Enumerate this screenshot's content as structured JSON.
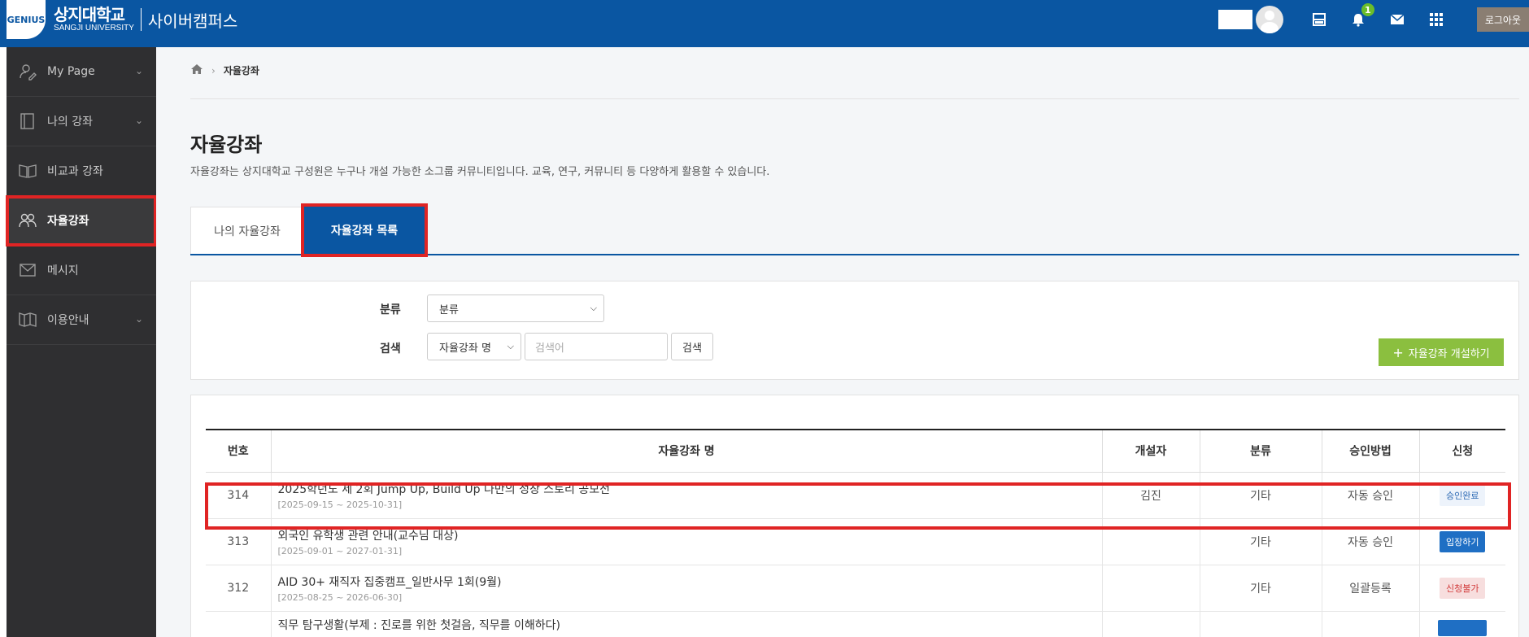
{
  "header": {
    "logo_emblem": "GENIUS",
    "logo_kr": "상지대학교",
    "logo_en": "SANGJI UNIVERSITY",
    "site_name": "사이버캠퍼스",
    "notification_count": "1",
    "logout_label": "로그아웃",
    "icons": [
      "avatar",
      "layout-icon",
      "bell-icon",
      "mail-icon",
      "apps-grid-icon"
    ]
  },
  "sidebar": {
    "items": [
      {
        "label": "My Page",
        "icon": "user-edit-icon",
        "has_chevron": true
      },
      {
        "label": "나의 강좌",
        "icon": "book-icon",
        "has_chevron": true
      },
      {
        "label": "비교과 강좌",
        "icon": "open-book-icon",
        "has_chevron": false
      },
      {
        "label": "자율강좌",
        "icon": "group-icon",
        "has_chevron": false,
        "active": true
      },
      {
        "label": "메시지",
        "icon": "mail-icon",
        "has_chevron": false
      },
      {
        "label": "이용안내",
        "icon": "guide-icon",
        "has_chevron": true
      }
    ]
  },
  "breadcrumb": {
    "current": "자율강좌"
  },
  "page": {
    "title": "자율강좌",
    "description": "자율강좌는 상지대학교 구성원은 누구나 개설 가능한 소그룹 커뮤니티입니다. 교육, 연구, 커뮤니티 등 다양하게 활용할 수 있습니다."
  },
  "tabs": [
    {
      "label": "나의 자율강좌",
      "active": false
    },
    {
      "label": "자율강좌 목록",
      "active": true
    }
  ],
  "filters": {
    "category_label": "분류",
    "category_selected": "분류",
    "search_label": "검색",
    "search_field_selected": "자율강좌 명",
    "search_placeholder": "검색어",
    "search_button": "검색",
    "create_button": "자율강좌 개설하기"
  },
  "table": {
    "columns": [
      "번호",
      "자율강좌 명",
      "개설자",
      "분류",
      "승인방법",
      "신청"
    ],
    "rows": [
      {
        "no": "314",
        "title": "2025학년도 제 2회 Jump Up, Build Up 나만의 성장 스토리 공모전",
        "period": "[2025-09-15 ~ 2025-10-31]",
        "creator": "김진",
        "category": "기타",
        "approval": "자동 승인",
        "status": "승인완료",
        "status_type": "approved"
      },
      {
        "no": "313",
        "title": "외국인 유학생 관련 안내(교수님 대상)",
        "period": "[2025-09-01 ~ 2027-01-31]",
        "creator": "",
        "category": "기타",
        "approval": "자동 승인",
        "status": "입장하기",
        "status_type": "enter"
      },
      {
        "no": "312",
        "title": "AID 30+ 재직자 집중캠프_일반사무 1회(9월)",
        "period": "[2025-08-25 ~ 2026-06-30]",
        "creator": "",
        "category": "기타",
        "approval": "일괄등록",
        "status": "신청불가",
        "status_type": "closed"
      },
      {
        "no": "",
        "title": "직무 탐구생활(부제 : 진로를 위한 첫걸음, 직무를 이해하다)",
        "period": "",
        "creator": "",
        "category": "",
        "approval": "",
        "status": "",
        "status_type": "enter"
      }
    ]
  }
}
